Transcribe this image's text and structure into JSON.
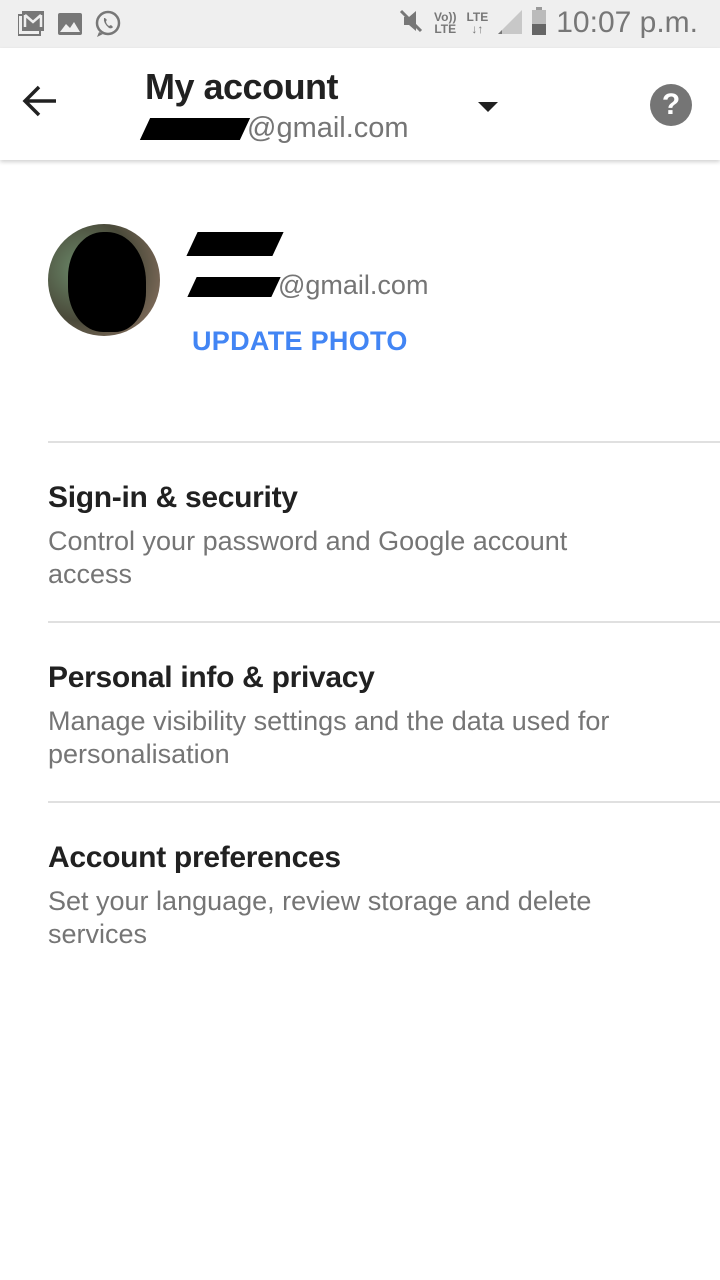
{
  "status_bar": {
    "left_icons": [
      "gmail-icon",
      "gallery-icon",
      "whatsapp-icon"
    ],
    "right_icons": [
      "mute-icon",
      "volte-icon",
      "lte-data-icon",
      "signal-icon",
      "battery-icon"
    ],
    "volte_label_top": "Vo))",
    "volte_label_bottom": "LTE",
    "lte_label": "LTE",
    "lte_arrows": "↓↑",
    "time": "10:07 p.m."
  },
  "app_bar": {
    "title": "My account",
    "account_email_suffix": "@gmail.com",
    "help_label": "?"
  },
  "profile": {
    "email_suffix": "@gmail.com",
    "update_photo_label": "UPDATE PHOTO",
    "accent_color": "#4285f4"
  },
  "menu_items": [
    {
      "title": "Sign-in & security",
      "description": "Control your password and Google account access"
    },
    {
      "title": "Personal info & privacy",
      "description": "Manage visibility settings and the data used for personalisation"
    },
    {
      "title": "Account preferences",
      "description": "Set your language, review storage and delete services"
    }
  ]
}
